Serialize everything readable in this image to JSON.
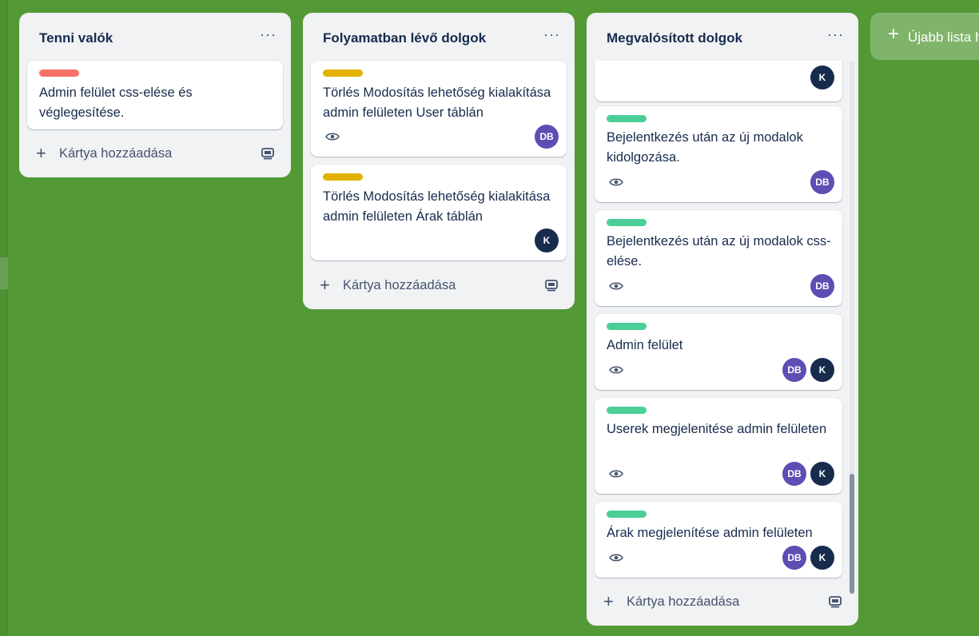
{
  "colors": {
    "board_bg": "#539a36",
    "label_red": "#f87168",
    "label_yellow": "#e2b203",
    "label_green": "#4bce97",
    "avatar_db": "#5e4db2",
    "avatar_k": "#172b4d"
  },
  "icons": {
    "more": "more-dots-icon",
    "watch": "eye-icon",
    "add": "plus-icon",
    "template": "card-template-icon"
  },
  "lists": [
    {
      "title": "Tenni valók",
      "more": "···",
      "cards": [
        {
          "label_color": "red",
          "text": "Admin felület css-elése és véglegesítése.",
          "members": []
        }
      ],
      "add_label": "Kártya hozzáadása"
    },
    {
      "title": "Folyamatban lévő dolgok",
      "more": "···",
      "cards": [
        {
          "label_color": "yellow",
          "text": "Törlés Modosítás lehetőség kialakítása admin felületen User táblán",
          "members": [
            "DB"
          ]
        },
        {
          "label_color": "yellow",
          "text": "Törlés Modosítás lehetőség kialakitása admin felületen Árak táblán",
          "members": [
            "K"
          ]
        }
      ],
      "add_label": "Kártya hozzáadása"
    },
    {
      "title": "Megvalósított dolgok",
      "more": "···",
      "cards": [
        {
          "label_color": "",
          "text": "",
          "members": [
            "K"
          ]
        },
        {
          "label_color": "green",
          "text": "Bejelentkezés után az új modalok kidolgozása.",
          "members": [
            "DB"
          ]
        },
        {
          "label_color": "green",
          "text": "Bejelentkezés után az új modalok css-elése.",
          "members": [
            "DB"
          ]
        },
        {
          "label_color": "green",
          "text": "Admin felület",
          "members": [
            "DB",
            "K"
          ]
        },
        {
          "label_color": "green",
          "text": "Userek megjelenitése admin felületen",
          "members": [
            "DB",
            "K"
          ]
        },
        {
          "label_color": "green",
          "text": "Árak megjelenítése admin felületen",
          "members": [
            "DB",
            "K"
          ]
        }
      ],
      "add_label": "Kártya hozzáadása"
    }
  ],
  "new_list": {
    "plus": "+",
    "label": "Újabb lista h"
  }
}
